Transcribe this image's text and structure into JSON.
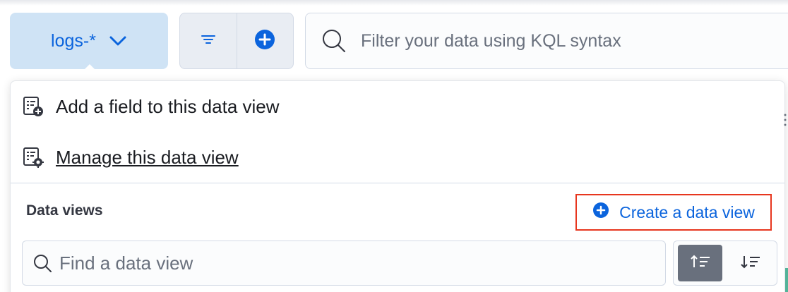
{
  "toolbar": {
    "data_view_label": "logs-*",
    "query_placeholder": "Filter your data using KQL syntax"
  },
  "popover": {
    "menu": [
      {
        "label": "Add a field to this data view",
        "icon": "add-field-icon"
      },
      {
        "label": "Manage this data view",
        "icon": "manage-data-view-icon"
      }
    ],
    "section_title": "Data views",
    "create_label": "Create a data view",
    "search_placeholder": "Find a data view",
    "sort": [
      {
        "icon": "sort-ascending-icon",
        "active": true
      },
      {
        "icon": "sort-descending-icon",
        "active": false
      }
    ]
  },
  "colors": {
    "primary": "#0b64dd",
    "highlight_border": "#e7361e",
    "data_view_button_bg": "#cfe3f5"
  }
}
